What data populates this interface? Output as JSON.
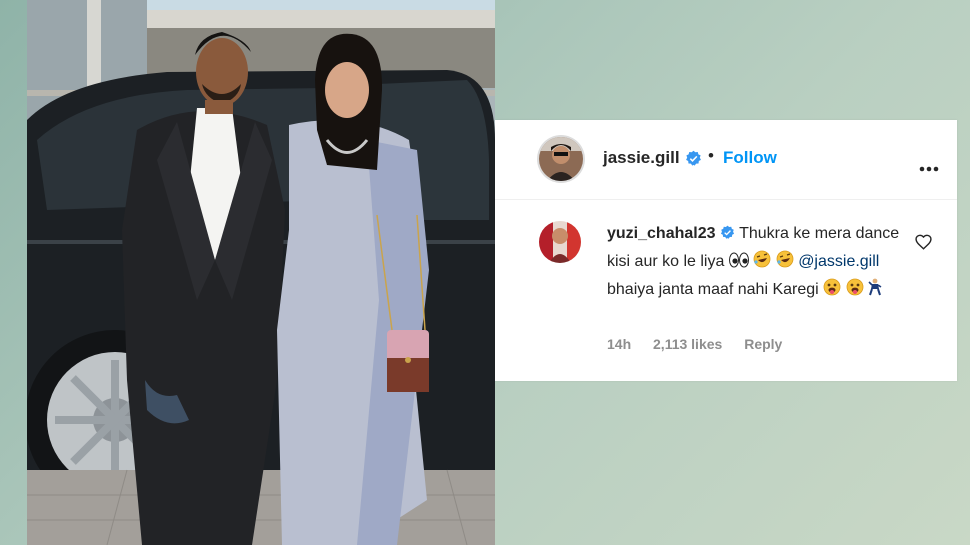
{
  "post": {
    "author_username": "jassie.gill",
    "separator": "•",
    "follow_label": "Follow",
    "photo_alt": "Couple posing in front of a dark SUV"
  },
  "comment": {
    "username": "yuzi_chahal23",
    "text_part1": "Thukra ke mera dance kisi aur ko le liya",
    "mention": "@jassie.gill",
    "text_part2": "bhaiya janta maaf nahi Karegi",
    "time": "14h",
    "likes": "2,113 likes",
    "reply_label": "Reply"
  },
  "colors": {
    "link": "#0095f6",
    "mention": "#00376b",
    "text": "#262626",
    "muted": "#8e8e8e"
  }
}
